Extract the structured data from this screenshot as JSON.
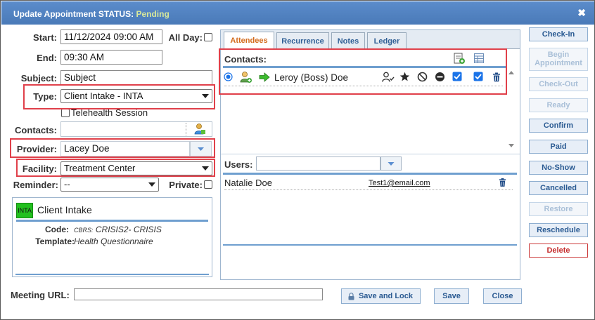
{
  "dialog": {
    "title_prefix": "Update Appointment STATUS:",
    "status": "Pending",
    "close_label": "✖"
  },
  "form": {
    "start_label": "Start:",
    "start_value": "11/12/2024 09:00 AM",
    "allday_label": "All Day:",
    "end_label": "End:",
    "end_value": "09:30 AM",
    "subject_label": "Subject:",
    "subject_value": "Subject",
    "type_label": "Type:",
    "type_value": "Client Intake - INTA",
    "telehealth_label": "Telehealth Session",
    "contacts_label": "Contacts:",
    "contacts_value": "",
    "provider_label": "Provider:",
    "provider_value": "Lacey Doe",
    "facility_label": "Facility:",
    "facility_value": "Treatment Center",
    "reminder_label": "Reminder:",
    "reminder_value": "--",
    "private_label": "Private:",
    "meeting_url_label": "Meeting URL:",
    "meeting_url_value": ""
  },
  "type_card": {
    "badge": "INTA",
    "badge_color": "#22c01f",
    "title": "Client Intake",
    "code_label": "Code:",
    "code_value_small": "CBRS:",
    "code_value": "CRISIS2- CRISIS",
    "template_label": "Template:",
    "template_value": "Health Questionnaire"
  },
  "tabs": [
    {
      "label": "Attendees",
      "active": true
    },
    {
      "label": "Recurrence",
      "active": false
    },
    {
      "label": "Notes",
      "active": false
    },
    {
      "label": "Ledger",
      "active": false
    }
  ],
  "attendees": {
    "contacts_header": "Contacts:",
    "contact_name": "Leroy (Boss) Doe",
    "users_label": "Users:",
    "users_value": "",
    "user_name": "Natalie Doe",
    "user_email": "Test1@email.com"
  },
  "side_buttons": [
    {
      "label": "Check-In",
      "state": "enabled"
    },
    {
      "label": "Begin Appointment",
      "state": "disabled"
    },
    {
      "label": "Check-Out",
      "state": "disabled"
    },
    {
      "label": "Ready",
      "state": "disabled"
    },
    {
      "label": "Confirm",
      "state": "enabled"
    },
    {
      "label": "Paid",
      "state": "enabled"
    },
    {
      "label": "No-Show",
      "state": "enabled"
    },
    {
      "label": "Cancelled",
      "state": "enabled"
    },
    {
      "label": "Restore",
      "state": "disabled"
    },
    {
      "label": "Reschedule",
      "state": "enabled"
    },
    {
      "label": "Delete",
      "state": "danger"
    }
  ],
  "footer": {
    "save_lock_label": "Save and Lock",
    "save_label": "Save",
    "close_label": "Close"
  },
  "colors": {
    "title_bar": "#4f81bd",
    "highlight": "#e0404a",
    "accent_tab": "#d36a1b"
  }
}
